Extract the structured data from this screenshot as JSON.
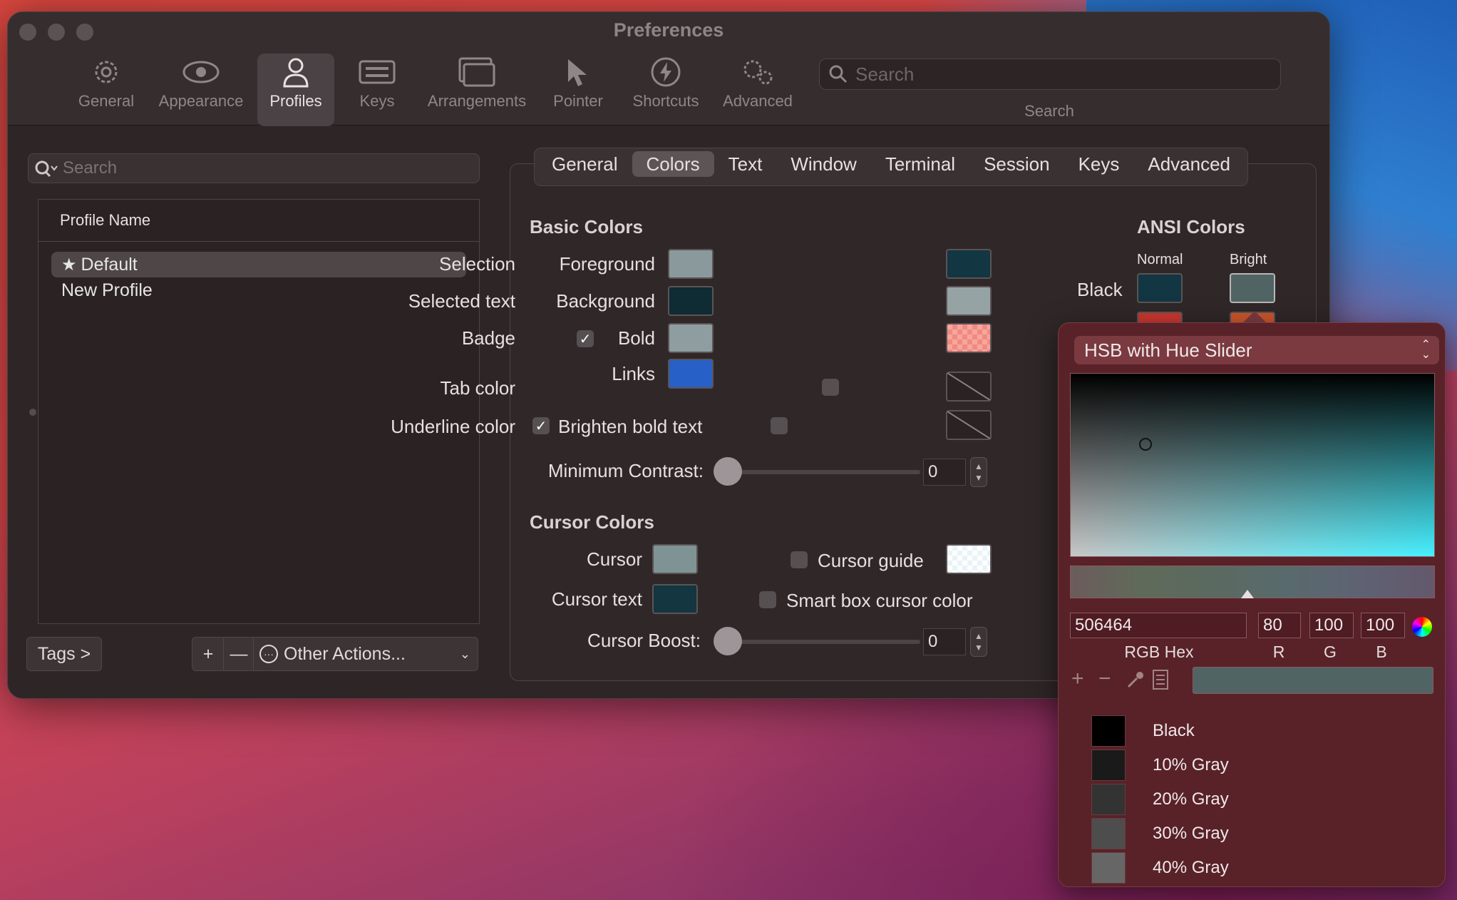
{
  "window": {
    "title": "Preferences"
  },
  "toolbar": {
    "items": [
      {
        "label": "General",
        "icon": "gear-icon"
      },
      {
        "label": "Appearance",
        "icon": "eye-icon"
      },
      {
        "label": "Profiles",
        "icon": "person-icon",
        "active": true
      },
      {
        "label": "Keys",
        "icon": "keyboard-icon"
      },
      {
        "label": "Arrangements",
        "icon": "windows-icon"
      },
      {
        "label": "Pointer",
        "icon": "pointer-icon"
      },
      {
        "label": "Shortcuts",
        "icon": "lightning-icon"
      },
      {
        "label": "Advanced",
        "icon": "gears-icon"
      }
    ],
    "search_placeholder": "Search",
    "search_caption": "Search"
  },
  "sidebar": {
    "search_placeholder": "Search",
    "column_header": "Profile Name",
    "profiles": [
      {
        "name": "Default",
        "selected": true
      },
      {
        "name": "New Profile"
      }
    ],
    "tags_button": "Tags >",
    "add_button": "+",
    "remove_button": "—",
    "other_actions": "Other Actions..."
  },
  "tabs": [
    "General",
    "Colors",
    "Text",
    "Window",
    "Terminal",
    "Session",
    "Keys",
    "Advanced"
  ],
  "active_tab": "Colors",
  "basic_colors": {
    "title": "Basic Colors",
    "foreground": "Foreground",
    "background": "Background",
    "bold": "Bold",
    "links": "Links",
    "brighten": "Brighten bold text",
    "selection": "Selection",
    "selected_text": "Selected text",
    "badge": "Badge",
    "tab_color": "Tab color",
    "underline_color": "Underline color",
    "min_contrast_label": "Minimum Contrast:",
    "min_contrast_value": "0"
  },
  "cursor_colors": {
    "title": "Cursor Colors",
    "cursor": "Cursor",
    "cursor_text": "Cursor text",
    "cursor_guide": "Cursor guide",
    "smart_box": "Smart box cursor color",
    "boost_label": "Cursor Boost:",
    "boost_value": "0"
  },
  "ansi": {
    "title": "ANSI Colors",
    "normal": "Normal",
    "bright": "Bright",
    "black": "Black"
  },
  "colors": {
    "foreground": "#8a9a9c",
    "background": "#0f2b33",
    "bold": "#8e9ea0",
    "links": "#2760c6",
    "selection": "#123642",
    "selected_text": "#95a3a4",
    "badge": "#f08a80",
    "cursor": "#7f9394",
    "cursor_text": "#133640",
    "ansi_black_normal": "#123642",
    "ansi_black_bright": "#506464",
    "ansi_red_normal": "#c8372f",
    "ansi_red_bright": "#c8552a"
  },
  "picker": {
    "mode": "HSB with Hue Slider",
    "hex": "506464",
    "hex_label": "RGB Hex",
    "r": "80",
    "g": "100",
    "b": "100",
    "r_label": "R",
    "g_label": "G",
    "b_label": "B",
    "presets": [
      {
        "name": "Black",
        "color": "#000000"
      },
      {
        "name": "10% Gray",
        "color": "#1a1a1a"
      },
      {
        "name": "20% Gray",
        "color": "#333333"
      },
      {
        "name": "30% Gray",
        "color": "#4d4d4d"
      },
      {
        "name": "40% Gray",
        "color": "#666666"
      }
    ]
  }
}
